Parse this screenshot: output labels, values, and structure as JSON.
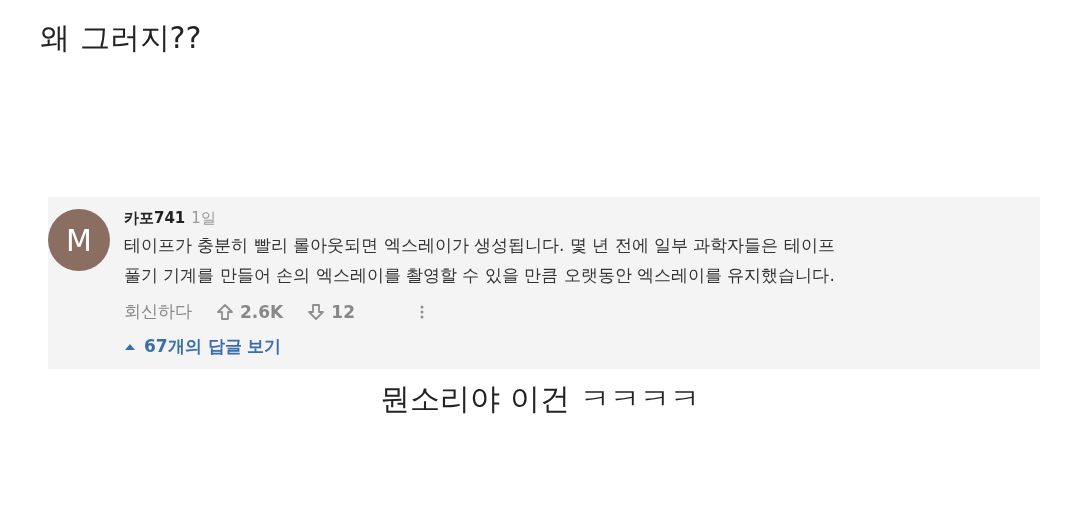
{
  "post_title": "왜 그러지??",
  "comment": {
    "avatar_letter": "M",
    "author": "카포741",
    "time": "1일",
    "text": "테이프가 충분히 빨리 롤아웃되면 엑스레이가 생성됩니다. 몇 년 전에 일부 과학자들은 테이프\n풀기 기계를 만들어 손의 엑스레이를 촬영할 수 있을 만큼 오랫동안 엑스레이를 유지했습니다.",
    "reply_label": "회신하다",
    "likes": "2.6K",
    "dislikes": "12",
    "replies_label": "67개의 답글 보기",
    "replies_expanded": false
  },
  "caption": "뭔소리야 이건 ㅋㅋㅋㅋ"
}
